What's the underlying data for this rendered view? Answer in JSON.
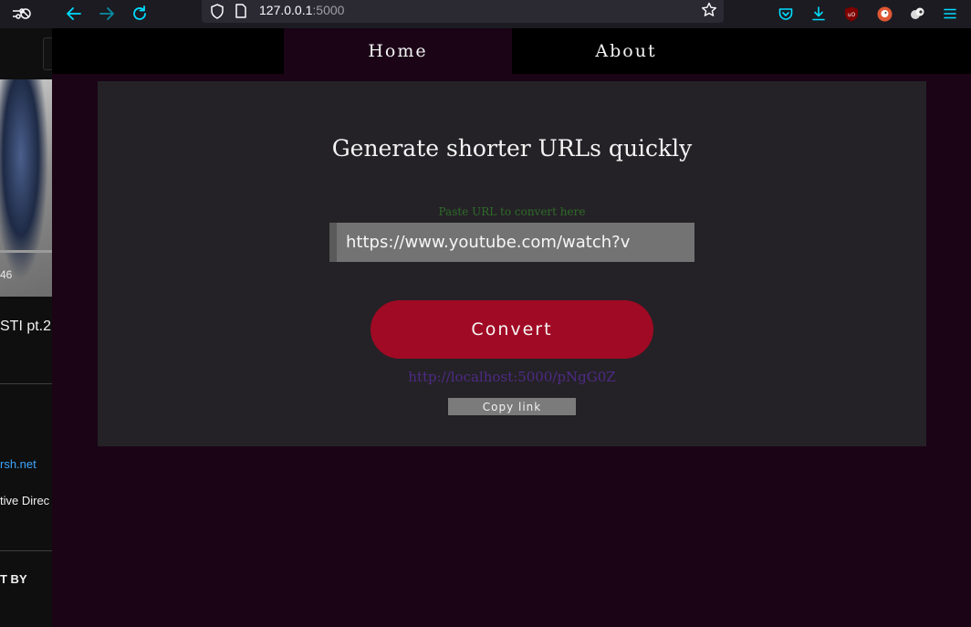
{
  "browser": {
    "address_host": "127.0.0.1",
    "address_port": ":5000",
    "colors": {
      "accent": "#00ddff",
      "ublock": "#800000",
      "duckduckgo": "#de5833"
    },
    "icons": [
      "tracking-protection-icon",
      "back-icon",
      "forward-icon",
      "reload-icon",
      "shield-icon",
      "page-icon",
      "bookmark-star-icon",
      "pocket-icon",
      "downloads-icon",
      "ublock-icon",
      "duckduckgo-icon",
      "extension-icon",
      "menu-icon"
    ]
  },
  "background_page": {
    "duration": "46",
    "video_title": "STI pt.2",
    "link": "rsh.net",
    "role": "tive Direc",
    "section": "T BY"
  },
  "nav": {
    "items": [
      {
        "label": "Home",
        "active": true
      },
      {
        "label": "About",
        "active": false
      }
    ]
  },
  "main": {
    "title": "Generate shorter URLs quickly",
    "input_hint": "Paste URL to convert here",
    "input_value": "https://www.youtube.com/watch?v=",
    "convert_label": "Convert",
    "short_url": "http://localhost:5000/pNgG0Z",
    "copy_label": "Copy link"
  },
  "colors": {
    "page_bg": "#1a0416",
    "card_bg": "#242226",
    "convert_button": "#a00a24",
    "link": "#4e2a86",
    "hint": "#2f6b2a"
  }
}
